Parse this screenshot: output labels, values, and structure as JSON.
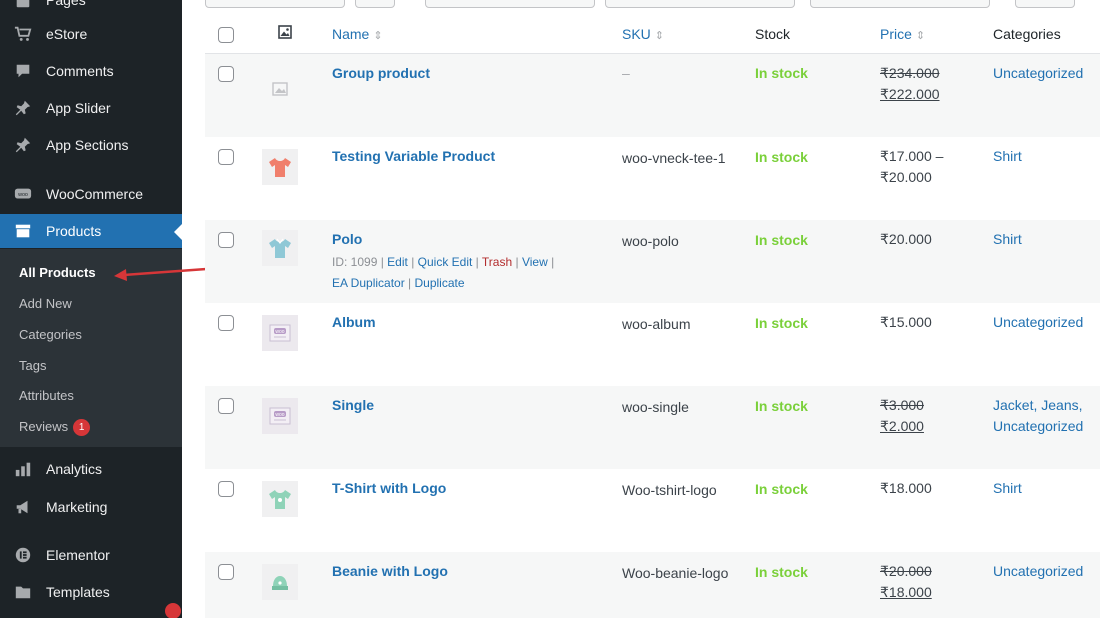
{
  "sidebar": {
    "items": [
      {
        "label": "Pages",
        "icon": "page-icon"
      },
      {
        "label": "eStore",
        "icon": "cart-icon"
      },
      {
        "label": "Comments",
        "icon": "comment-icon"
      },
      {
        "label": "App Slider",
        "icon": "pin-icon"
      },
      {
        "label": "App Sections",
        "icon": "pin-icon"
      },
      {
        "label": "WooCommerce",
        "icon": "woo-icon"
      },
      {
        "label": "Products",
        "icon": "archive-icon"
      },
      {
        "label": "Analytics",
        "icon": "bar-chart-icon"
      },
      {
        "label": "Marketing",
        "icon": "megaphone-icon"
      },
      {
        "label": "Elementor",
        "icon": "elementor-icon"
      },
      {
        "label": "Templates",
        "icon": "folder-icon"
      }
    ],
    "submenu": [
      {
        "label": "All Products"
      },
      {
        "label": "Add New"
      },
      {
        "label": "Categories"
      },
      {
        "label": "Tags"
      },
      {
        "label": "Attributes"
      },
      {
        "label": "Reviews",
        "badge": "1"
      }
    ]
  },
  "table": {
    "headers": {
      "name": "Name",
      "sku": "SKU",
      "stock": "Stock",
      "price": "Price",
      "categories": "Categories"
    },
    "rows": [
      {
        "name": "Group product",
        "sku": "–",
        "stock": "In stock",
        "price_old": "₹234.000",
        "price_new": "₹222.000",
        "category": "Uncategorized",
        "thumb": "placeholder-image-icon"
      },
      {
        "name": "Testing Variable Product",
        "sku": "woo-vneck-tee-1",
        "stock": "In stock",
        "price_range_1": "₹17.000 –",
        "price_range_2": "₹20.000",
        "category": "Shirt",
        "thumb": "red-tshirt-icon"
      },
      {
        "name": "Polo",
        "sku": "woo-polo",
        "stock": "In stock",
        "price": "₹20.000",
        "category": "Shirt",
        "thumb": "blue-polo-icon",
        "actions": {
          "id": "ID: 1099 |",
          "edit": "Edit",
          "quick_edit": "Quick Edit",
          "trash": "Trash",
          "view": "View",
          "duplicator": "EA Duplicator",
          "duplicate": "Duplicate"
        }
      },
      {
        "name": "Album",
        "sku": "woo-album",
        "stock": "In stock",
        "price": "₹15.000",
        "category": "Uncategorized",
        "thumb": "album-icon"
      },
      {
        "name": "Single",
        "sku": "woo-single",
        "stock": "In stock",
        "price_old": "₹3.000",
        "price_new": "₹2.000",
        "category_1": "Jacket, Jeans,",
        "category_2": "Uncategorized",
        "thumb": "single-icon"
      },
      {
        "name": "T-Shirt with Logo",
        "sku": "Woo-tshirt-logo",
        "stock": "In stock",
        "price": "₹18.000",
        "category": "Shirt",
        "thumb": "green-tshirt-icon"
      },
      {
        "name": "Beanie with Logo",
        "sku": "Woo-beanie-logo",
        "stock": "In stock",
        "price_old": "₹20.000",
        "price_new": "₹18.000",
        "category": "Uncategorized",
        "thumb": "beanie-icon"
      }
    ]
  },
  "colors": {
    "sidebar_bg": "#1d2327",
    "active_bg": "#2271b1",
    "link": "#2271b1",
    "in_stock": "#7ad03a",
    "trash": "#b32d2e",
    "badge": "#d63638",
    "arrow": "#d63638"
  }
}
